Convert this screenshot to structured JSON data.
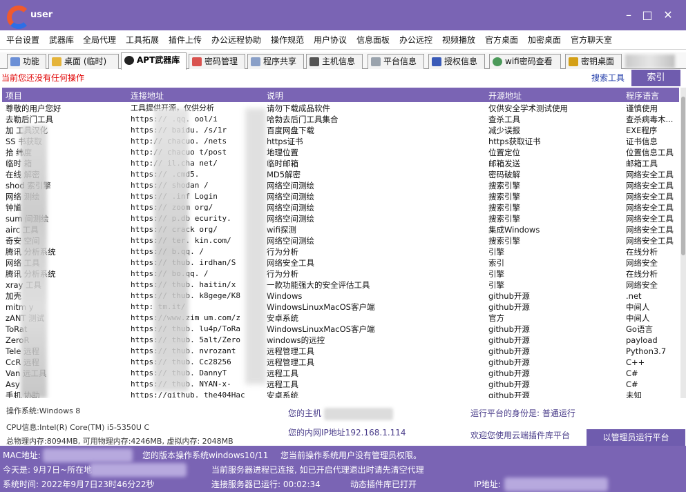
{
  "app": {
    "logo_text": "user",
    "colors": {
      "accent": "#7a64b4",
      "button": "#6f5cae",
      "error": "#e00000",
      "link": "#1e3aa8"
    }
  },
  "window_controls": {
    "minimize": "–",
    "maximize": "□",
    "close": "✕"
  },
  "menu": [
    "平台设置",
    "武器库",
    "全局代理",
    "工具拓展",
    "插件上传",
    "办公远程协助",
    "操作规范",
    "用户协议",
    "信息面板",
    "办公远控",
    "视频播放",
    "官方桌面",
    "加密桌面",
    "官方聊天室"
  ],
  "tabs": [
    {
      "label": "功能",
      "icon": "function-icon"
    },
    {
      "label": "桌面 (临时)",
      "icon": "folder-icon"
    },
    {
      "label": "APT武器库",
      "icon": "apt-icon",
      "active": true
    },
    {
      "label": "密码管理",
      "icon": "password-icon"
    },
    {
      "label": "程序共享",
      "icon": "share-icon"
    },
    {
      "label": "主机信息",
      "icon": "host-icon"
    },
    {
      "label": "平台信息",
      "icon": "platform-icon"
    },
    {
      "label": "授权信息",
      "icon": "license-icon"
    },
    {
      "label": "wifi密码查看",
      "icon": "wifi-icon"
    },
    {
      "label": "密钥桌面",
      "icon": "lock-icon"
    }
  ],
  "status_message": "当前您还没有任何操作",
  "search_label": "搜索工具",
  "index_button": "索引",
  "table": {
    "headers": [
      "项目",
      "连接地址",
      "说明",
      "开源地址",
      "程序语言"
    ],
    "rows": [
      [
        "尊敬的用户您好",
        "工具提供开源，仅供分析",
        "请勿下载成品软件",
        "仅供安全学术测试使用",
        "谨慎使用"
      ],
      [
        "去勒后门工具",
        "https://   .qq.    ool/i",
        "哈勃去后门工具集合",
        "查杀工具",
        "查杀病毒木..."
      ],
      [
        "加   工具汉化",
        "https://   baidu.   /s/1r",
        "百度网盘下载",
        "减少误报",
        "EXE程序"
      ],
      [
        "SS    书获取",
        "http://   chacuo.    /nets",
        "https证书",
        "https获取证书",
        "证书信息"
      ],
      [
        "拾   纬度",
        "http://   chacuo    t/post",
        "地理位置",
        "位置定位",
        "位置信息工具"
      ],
      [
        "临时   箱",
        "http://    il.cha    net/",
        "临时邮箱",
        "邮箱发送",
        "邮箱工具"
      ],
      [
        "在线   解密",
        "https://    .cmd5.",
        "MD5解密",
        "密码破解",
        "网络安全工具"
      ],
      [
        "shod   索引擎",
        "https://    shodan   /",
        "网络空间测绘",
        "搜索引擎",
        "网络安全工具"
      ],
      [
        "网络   测绘",
        "https://   .inf   Login",
        "网络空间测绘",
        "搜索引擎",
        "网络安全工具"
      ],
      [
        "钟馗   ",
        "https://   zoom   org/",
        "网络空间测绘",
        "搜索引擎",
        "网络安全工具"
      ],
      [
        "sum   间测绘",
        "https://   p.db   ecurity.",
        "网络空间测绘",
        "搜索引擎",
        "网络安全工具"
      ],
      [
        "airc   工具",
        "https://   crack   org/",
        "wifi探测",
        "集成Windows",
        "网络安全工具"
      ],
      [
        "奇安   空间",
        "https://   ter.    kin.com/",
        "网络空间测绘",
        "搜索引擎",
        "网络安全工具"
      ],
      [
        "腾讯   分析系统",
        "https://   b.qq.    /",
        "行为分析",
        "引擎",
        "在线分析"
      ],
      [
        "网络   工具",
        "https://   thub.    irdhan/S",
        "网络安全工具",
        "索引",
        "网络安全"
      ],
      [
        "腾讯   分析系统",
        "https://   bo.qq.    /",
        "行为分析",
        "引擎",
        "在线分析"
      ],
      [
        "xray   工具",
        "https://   thub.    haitin/x",
        "一款功能强大的安全评估工具",
        "引擎",
        "网络安全"
      ],
      [
        "加壳   ",
        "https://   thub.    k8gege/K8",
        "Windows",
        "github开源",
        ".net"
      ],
      [
        "mitm   y",
        "http:    tm.it/",
        "WindowsLinuxMacOS客户端",
        "github开源",
        "中间人"
      ],
      [
        "zANT   测试",
        "https://www.zim   um.com/z",
        "安卓系统",
        "官方",
        "中间人"
      ],
      [
        "ToRat   ",
        "https://   thub.    lu4p/ToRa",
        "WindowsLinuxMacOS客户端",
        "github开源",
        "Go语言"
      ],
      [
        "ZeroR   ",
        "https://   thub.    5alt/Zero",
        "windows的远控",
        "github开源",
        "payload"
      ],
      [
        "Tele   远程",
        "https://   thub.    nvrozant",
        "远程管理工具",
        "github开源",
        "Python3.7"
      ],
      [
        "CcR   远程",
        "https://   thub.    Cc28256",
        "远程管理工具",
        "github开源",
        "C++"
      ],
      [
        "Van   远工具",
        "https://   thub.    DannyT",
        "远程工具",
        "github开源",
        "C#"
      ],
      [
        "Asy   ",
        "https://   thub.    NYAN-x-",
        "远程工具",
        "github开源",
        "C#"
      ],
      [
        "手机   协助",
        "https://github.    the404Hac",
        "安卓系统",
        "github开源",
        "未知"
      ]
    ]
  },
  "info": {
    "os": "操作系统:Windows 8",
    "cpu": "CPU信息:Intel(R) Core(TM) i5-5350U C",
    "memory": "总物理内存:8094MB, 可用物理内存:4246MB, 虚拟内存: 2048MB",
    "host_label": "您的主机",
    "lan_ip": "您的内网IP地址192.168.1.114",
    "identity": "运行平台的身份是: 普通运行",
    "welcome": "欢迎您使用云端插件库平台",
    "admin_button": "以管理员运行平台"
  },
  "footer": {
    "mac_label": "MAC地址:",
    "version": "您的版本操作系统windows10/11",
    "admin_status": "您当前操作系统用户没有管理员权限。",
    "today": "今天是:  9月7日~所在地",
    "proxy_notice": "当前服务器进程已连接, 如已开启代理退出时请先清空代理",
    "system_time": "系统时间: 2022年9月7日23时46分22秒",
    "server_uptime": "连接服务器已运行:  00:02:34",
    "plugin_status": "动态插件库已打开",
    "ip_label": "IP地址:"
  }
}
